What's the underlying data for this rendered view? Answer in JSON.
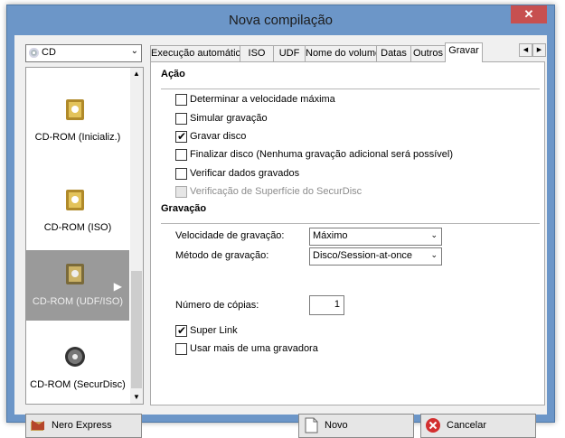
{
  "window": {
    "title": "Nova compilação"
  },
  "left": {
    "media": "CD",
    "items": [
      {
        "label": "CD-ROM (Inicializ.)",
        "icon": "cd-boot-icon"
      },
      {
        "label": "CD-ROM (ISO)",
        "icon": "cd-iso-icon"
      },
      {
        "label": "CD-ROM (UDF/ISO)",
        "icon": "cd-udf-iso-icon",
        "selected": true
      },
      {
        "label": "CD-ROM (SecurDisc)",
        "icon": "securdisc-icon"
      }
    ]
  },
  "tabs": [
    "Execução automática",
    "ISO",
    "UDF",
    "Nome do volume",
    "Datas",
    "Outros",
    "Gravar"
  ],
  "active_tab": "Gravar",
  "acao": {
    "heading": "Ação",
    "options": [
      {
        "label": "Determinar a velocidade máxima",
        "checked": false,
        "enabled": true
      },
      {
        "label": "Simular gravação",
        "checked": false,
        "enabled": true
      },
      {
        "label": "Gravar disco",
        "checked": true,
        "enabled": true
      },
      {
        "label": "Finalizar disco (Nenhuma gravação adicional será possível)",
        "checked": false,
        "enabled": true
      },
      {
        "label": "Verificar dados gravados",
        "checked": false,
        "enabled": true
      },
      {
        "label": "Verificação de Superfície do SecurDisc",
        "checked": false,
        "enabled": false
      }
    ]
  },
  "gravacao": {
    "heading": "Gravação",
    "speed_label": "Velocidade de gravação:",
    "speed_value": "Máximo",
    "method_label": "Método de gravação:",
    "method_value": "Disco/Session-at-once",
    "copies_label": "Número de cópias:",
    "copies_value": "1",
    "super_link": {
      "label": "Super Link",
      "checked": true
    },
    "multi": {
      "label": "Usar mais de uma gravadora",
      "checked": false
    }
  },
  "buttons": {
    "nero_express": "Nero Express",
    "novo": "Novo",
    "cancelar": "Cancelar"
  },
  "colors": {
    "titlebar": "#6c96c8",
    "close": "#c75050",
    "selected_item": "#9a9a9a"
  }
}
